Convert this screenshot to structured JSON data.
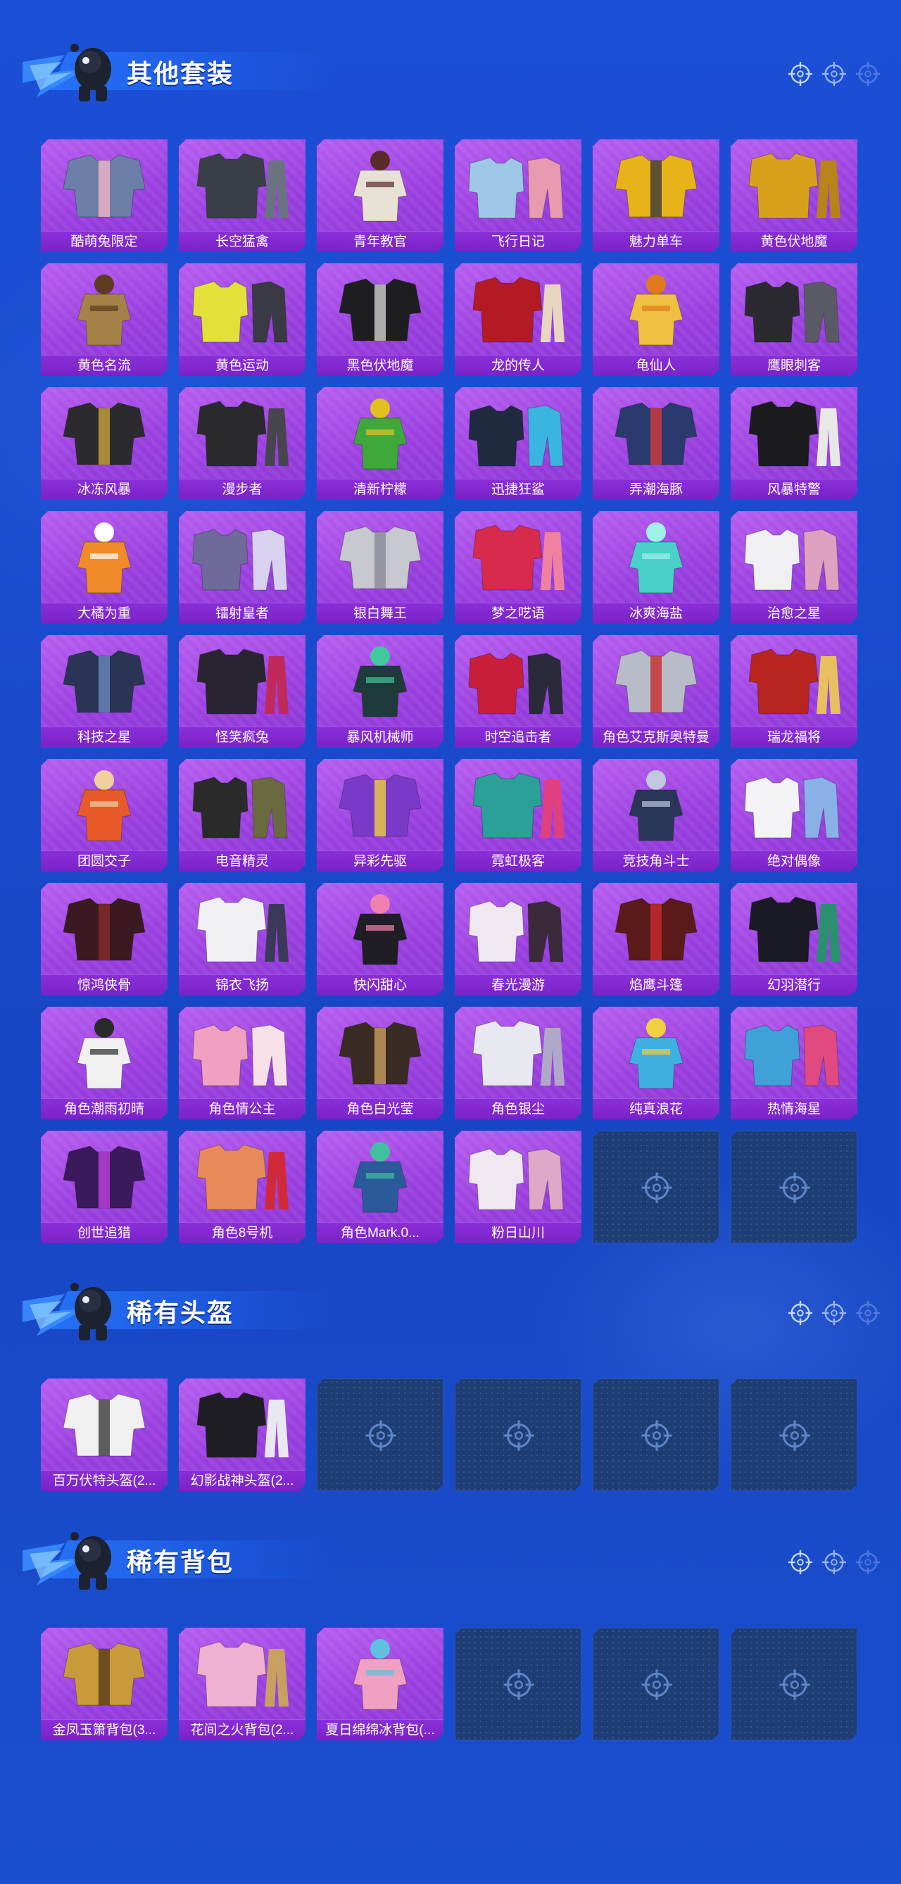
{
  "sections": [
    {
      "title": "其他套装",
      "items": [
        {
          "name": "酷萌兔限定",
          "color": "#6b7fa8",
          "accent": "#f3b7c7"
        },
        {
          "name": "长空猛禽",
          "color": "#3a3f47",
          "accent": "#6a7380"
        },
        {
          "name": "青年教官",
          "color": "#e8e2d6",
          "accent": "#5a2b2b"
        },
        {
          "name": "飞行日记",
          "color": "#9ec7e8",
          "accent": "#e89ab0"
        },
        {
          "name": "魅力单车",
          "color": "#e6b318",
          "accent": "#3a3a3a"
        },
        {
          "name": "黄色伏地魔",
          "color": "#d8a11c",
          "accent": "#b88318"
        },
        {
          "name": "黄色名流",
          "color": "#a48248",
          "accent": "#5b3c20"
        },
        {
          "name": "黄色运动",
          "color": "#e3e03a",
          "accent": "#3a3a44"
        },
        {
          "name": "黑色伏地魔",
          "color": "#1e1e22",
          "accent": "#d0d0d0"
        },
        {
          "name": "龙的传人",
          "color": "#b31a24",
          "accent": "#e8d6c0"
        },
        {
          "name": "龟仙人",
          "color": "#f0c040",
          "accent": "#e07a1e"
        },
        {
          "name": "鹰眼刺客",
          "color": "#2a2a30",
          "accent": "#5a5a66"
        },
        {
          "name": "冰冻风暴",
          "color": "#2b2b2f",
          "accent": "#c9a33a"
        },
        {
          "name": "漫步者",
          "color": "#2a2a2e",
          "accent": "#46464c"
        },
        {
          "name": "清新柠檬",
          "color": "#3ea83a",
          "accent": "#e2c020"
        },
        {
          "name": "迅捷狂鲨",
          "color": "#1f2a40",
          "accent": "#3ab4e0"
        },
        {
          "name": "弄潮海豚",
          "color": "#2a3a6e",
          "accent": "#d23a3a"
        },
        {
          "name": "风暴特警",
          "color": "#1a1a1f",
          "accent": "#e8e8e8"
        },
        {
          "name": "大橘为重",
          "color": "#f08a2a",
          "accent": "#ffffff"
        },
        {
          "name": "镭射皇者",
          "color": "#6e6a9a",
          "accent": "#d8d2f0"
        },
        {
          "name": "银白舞王",
          "color": "#c8c8d0",
          "accent": "#8a8a96"
        },
        {
          "name": "梦之呓语",
          "color": "#d82a4a",
          "accent": "#f080a0"
        },
        {
          "name": "冰爽海盐",
          "color": "#4ad0c8",
          "accent": "#a0f0e8"
        },
        {
          "name": "治愈之星",
          "color": "#f0f0f4",
          "accent": "#e0a0c0"
        },
        {
          "name": "科技之星",
          "color": "#2a3454",
          "accent": "#6a88c0"
        },
        {
          "name": "怪笑疯兔",
          "color": "#2a2430",
          "accent": "#c02a5a"
        },
        {
          "name": "暴风机械师",
          "color": "#1e3a3a",
          "accent": "#40c8a0"
        },
        {
          "name": "时空追击者",
          "color": "#c81e3a",
          "accent": "#2a2a3a"
        },
        {
          "name": "角色艾克斯奥特曼",
          "color": "#b8bcc8",
          "accent": "#c82a2a"
        },
        {
          "name": "瑞龙福将",
          "color": "#b82420",
          "accent": "#e8c060"
        },
        {
          "name": "团圆交子",
          "color": "#e85a2a",
          "accent": "#f0d0a0"
        },
        {
          "name": "电音精灵",
          "color": "#2a2a2a",
          "accent": "#6a6a40"
        },
        {
          "name": "异彩先驱",
          "color": "#7a3ac8",
          "accent": "#f0d040"
        },
        {
          "name": "霓虹极客",
          "color": "#2aa098",
          "accent": "#e04080"
        },
        {
          "name": "竞技角斗士",
          "color": "#2a3658",
          "accent": "#c0c8e0"
        },
        {
          "name": "绝对偶像",
          "color": "#f4f4f8",
          "accent": "#8ab0e8"
        },
        {
          "name": "惊鸿侠骨",
          "color": "#3a1a20",
          "accent": "#8a2a2a"
        },
        {
          "name": "锦衣飞扬",
          "color": "#f0f0f4",
          "accent": "#3a3a58"
        },
        {
          "name": "快闪甜心",
          "color": "#1e1e24",
          "accent": "#f080b0"
        },
        {
          "name": "春光漫游",
          "color": "#f0e8f0",
          "accent": "#3a2a3a"
        },
        {
          "name": "焰鹰斗篷",
          "color": "#5a1a1a",
          "accent": "#c82a2a"
        },
        {
          "name": "幻羽潜行",
          "color": "#1a1a24",
          "accent": "#2a9070"
        },
        {
          "name": "角色潮雨初晴",
          "color": "#f0f0f0",
          "accent": "#2a2a2a"
        },
        {
          "name": "角色情公主",
          "color": "#f0a0c0",
          "accent": "#f8e0e8"
        },
        {
          "name": "角色白光莹",
          "color": "#3a2a24",
          "accent": "#c8a060"
        },
        {
          "name": "角色银尘",
          "color": "#e8e8f0",
          "accent": "#b0a8c8"
        },
        {
          "name": "纯真浪花",
          "color": "#40b0e0",
          "accent": "#f0d040"
        },
        {
          "name": "热情海星",
          "color": "#40a0d8",
          "accent": "#e04a80"
        },
        {
          "name": "创世追猎",
          "color": "#3a1a5a",
          "accent": "#c040e0"
        },
        {
          "name": "角色8号机",
          "color": "#e88a5a",
          "accent": "#d02a3a"
        },
        {
          "name": "角色Mark.0...",
          "color": "#2a5a9a",
          "accent": "#40c0a0"
        },
        {
          "name": "粉日山川",
          "color": "#f0e8f0",
          "accent": "#e0a8c8"
        },
        {
          "empty": true
        },
        {
          "empty": true
        }
      ]
    },
    {
      "title": "稀有头盔",
      "items": [
        {
          "name": "百万伏特头盔(2...",
          "color": "#f0f0f0",
          "accent": "#3a3a3a"
        },
        {
          "name": "幻影战神头盔(2...",
          "color": "#1e1e24",
          "accent": "#e8e8f0"
        },
        {
          "empty": true
        },
        {
          "empty": true
        },
        {
          "empty": true
        },
        {
          "empty": true
        }
      ]
    },
    {
      "title": "稀有背包",
      "items": [
        {
          "name": "金凤玉箫背包(3...",
          "color": "#c89a3a",
          "accent": "#5a3a1a"
        },
        {
          "name": "花间之火背包(2...",
          "color": "#f0b0d0",
          "accent": "#c8a060"
        },
        {
          "name": "夏日绵绵冰背包(...",
          "color": "#f0a0c0",
          "accent": "#60c0e0"
        },
        {
          "empty": true
        },
        {
          "empty": true
        },
        {
          "empty": true
        }
      ]
    }
  ]
}
